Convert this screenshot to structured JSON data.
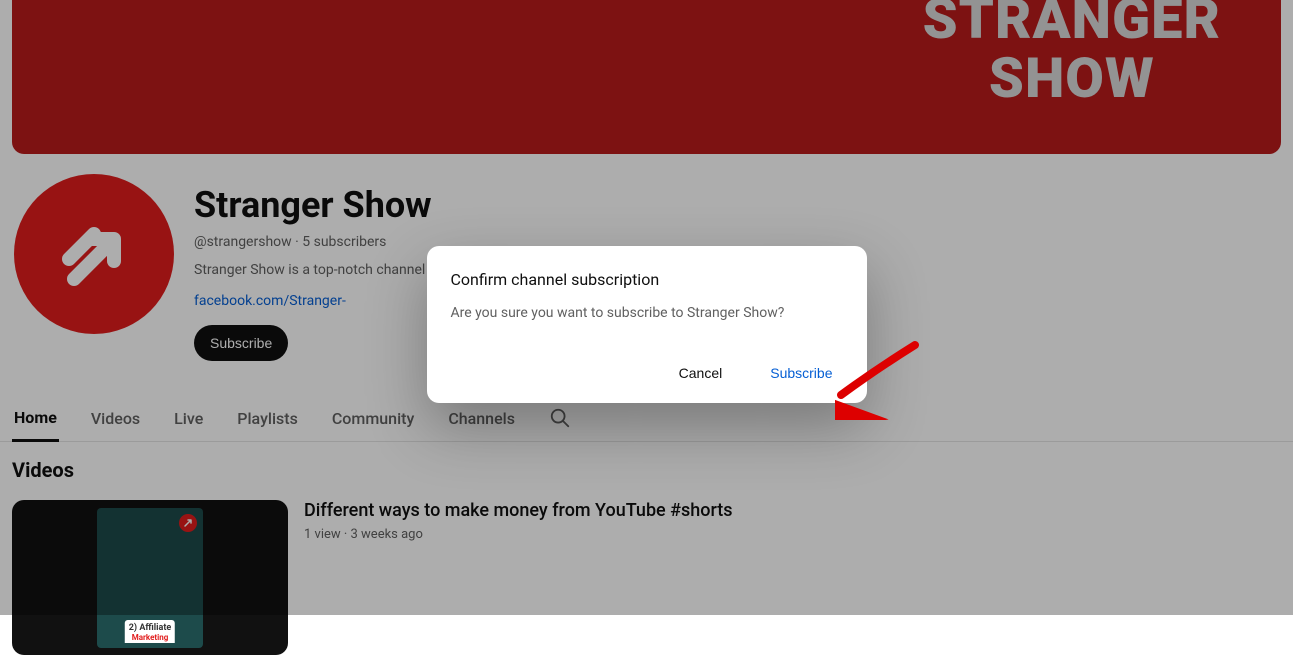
{
  "banner": {
    "text": "STRANGER\nSHOW"
  },
  "channel": {
    "name": "Stranger Show",
    "meta": "@strangershow · 5 subscribers",
    "descTruncated": "Stranger Show is a top-notch channel that helps you make money…",
    "link": "facebook.com/Stranger-",
    "subscribeLabel": "Subscribe"
  },
  "tabs": {
    "items": [
      {
        "label": "Home",
        "active": true
      },
      {
        "label": "Videos",
        "active": false
      },
      {
        "label": "Live",
        "active": false
      },
      {
        "label": "Playlists",
        "active": false
      },
      {
        "label": "Community",
        "active": false
      },
      {
        "label": "Channels",
        "active": false
      }
    ]
  },
  "section": {
    "title": "Videos"
  },
  "video": {
    "title": "Different ways to make money from YouTube #shorts",
    "meta": "1 view · 3 weeks ago",
    "thumbLine1": "2) Affiliate",
    "thumbLine2": "Marketing"
  },
  "dialog": {
    "title": "Confirm channel subscription",
    "body": "Are you sure you want to subscribe to Stranger Show?",
    "cancelLabel": "Cancel",
    "subscribeLabel": "Subscribe"
  }
}
